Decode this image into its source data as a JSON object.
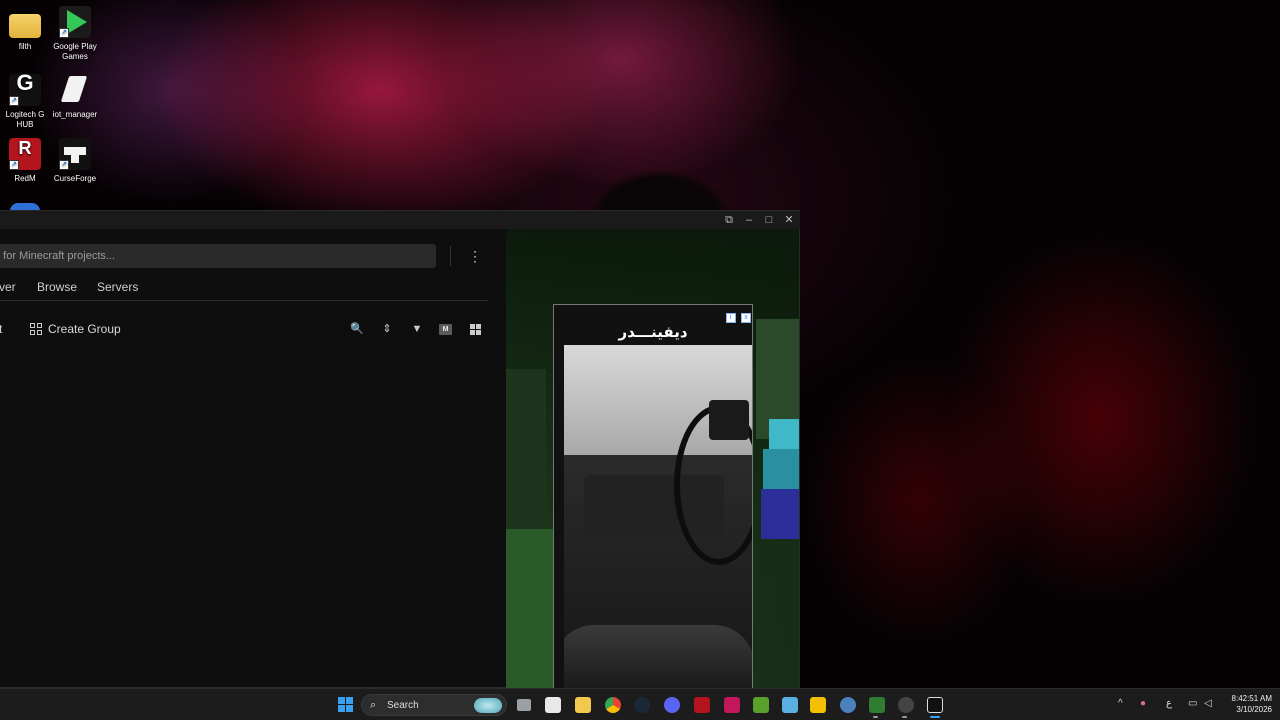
{
  "desktop": {
    "icons": [
      {
        "label": "filth"
      },
      {
        "label": "Google Play Games"
      },
      {
        "label": "Logitech G HUB"
      },
      {
        "label": "iot_manager"
      },
      {
        "label": "RedM"
      },
      {
        "label": "CurseForge"
      }
    ]
  },
  "window": {
    "controls": {
      "snap": "⧉",
      "minimize": "–",
      "maximize": "□",
      "close": "✕"
    },
    "search": {
      "placeholder": "h for Minecraft projects..."
    },
    "menu_icon": "⋮",
    "nav_tabs": [
      {
        "label": "ver"
      },
      {
        "label": "Browse"
      },
      {
        "label": "Servers"
      }
    ],
    "actions": {
      "partial_label": "t",
      "create_group_label": "Create Group",
      "view_mode_badge": "M"
    },
    "tool_icons": {
      "search": "🔍",
      "sort": "⇕",
      "filter": "▼"
    }
  },
  "ad": {
    "title": "ديفينـــدر",
    "badges": [
      "i",
      "x"
    ]
  },
  "taskbar": {
    "search_label": "Search",
    "tray": {
      "chevron": "^",
      "lang": "ع"
    },
    "clock": {
      "time": "8:42:51 AM",
      "date": "3/10/2026"
    },
    "accent": "#3aa0f0"
  }
}
